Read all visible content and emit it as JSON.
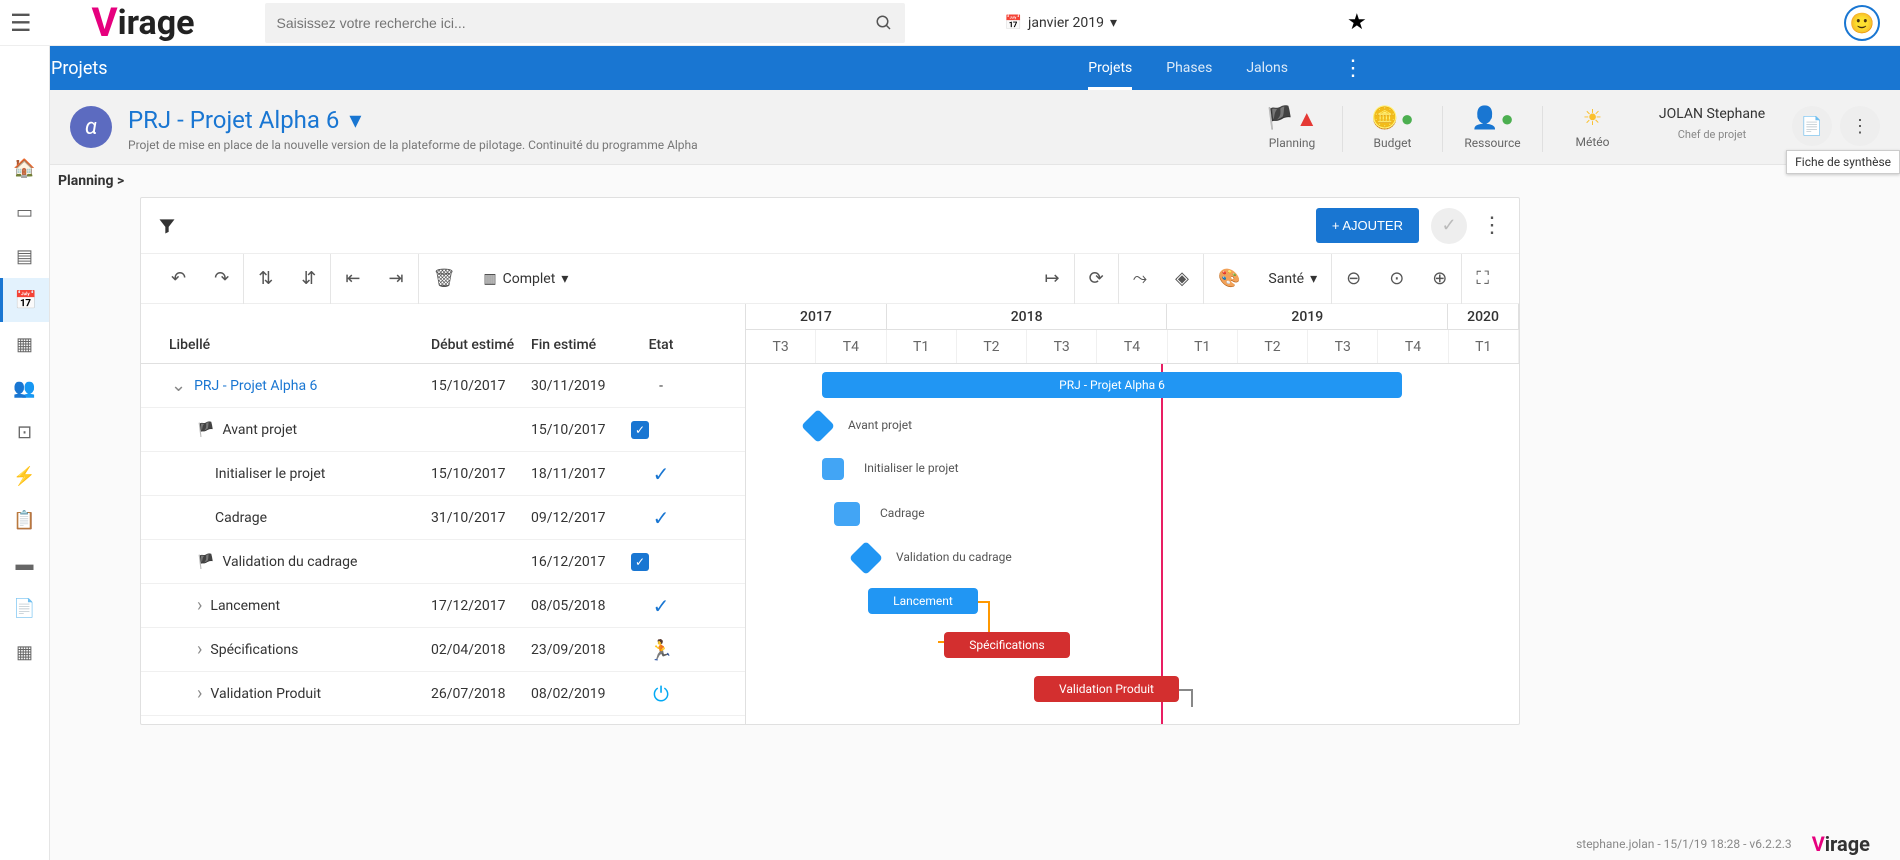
{
  "topbar": {
    "search_placeholder": "Saisissez votre recherche ici...",
    "date_label": "janvier 2019"
  },
  "bluenav": {
    "title": "Projets",
    "tabs": [
      "Projets",
      "Phases",
      "Jalons"
    ]
  },
  "project": {
    "avatar_letter": "α",
    "title": "PRJ - Projet Alpha 6",
    "description": "Projet de mise en place de la nouvelle version de la plateforme de pilotage. Continuité du programme Alpha",
    "stats": {
      "planning": "Planning",
      "budget": "Budget",
      "resource": "Ressource",
      "meteo": "Météo"
    },
    "chef_name": "JOLAN Stephane",
    "chef_label": "Chef de projet"
  },
  "tooltip": "Fiche de synthèse",
  "breadcrumb": "Planning >",
  "card": {
    "add_button": "+ AJOUTER",
    "view_label": "Complet",
    "sante_label": "Santé"
  },
  "gantt": {
    "headers": {
      "lib": "Libellé",
      "debut": "Début estimé",
      "fin": "Fin estimé",
      "etat": "Etat"
    },
    "years": [
      "2017",
      "2018",
      "2019",
      "2020"
    ],
    "quarters": [
      "T3",
      "T4",
      "T1",
      "T2",
      "T3",
      "T4",
      "T1",
      "T2",
      "T3",
      "T4",
      "T1"
    ],
    "rows": [
      {
        "label": "PRJ - Projet Alpha 6",
        "debut": "15/10/2017",
        "fin": "30/11/2019",
        "etat": "-"
      },
      {
        "label": "Avant projet",
        "debut": "",
        "fin": "15/10/2017",
        "etat": "check"
      },
      {
        "label": "Initialiser le projet",
        "debut": "15/10/2017",
        "fin": "18/11/2017",
        "etat": "done"
      },
      {
        "label": "Cadrage",
        "debut": "31/10/2017",
        "fin": "09/12/2017",
        "etat": "done"
      },
      {
        "label": "Validation du cadrage",
        "debut": "",
        "fin": "16/12/2017",
        "etat": "check"
      },
      {
        "label": "Lancement",
        "debut": "17/12/2017",
        "fin": "08/05/2018",
        "etat": "done"
      },
      {
        "label": "Spécifications",
        "debut": "02/04/2018",
        "fin": "23/09/2018",
        "etat": "run"
      },
      {
        "label": "Validation Produit",
        "debut": "26/07/2018",
        "fin": "08/02/2019",
        "etat": "power"
      }
    ],
    "bars": {
      "proj": "PRJ - Projet Alpha 6",
      "avant": "Avant projet",
      "init": "Initialiser le projet",
      "cadrage": "Cadrage",
      "valid": "Validation du cadrage",
      "lance": "Lancement",
      "spec": "Spécifications",
      "vprod": "Validation Produit"
    }
  },
  "footer": {
    "text": "stephane.jolan - 15/1/19 18:28 - v6.2.2.3"
  }
}
